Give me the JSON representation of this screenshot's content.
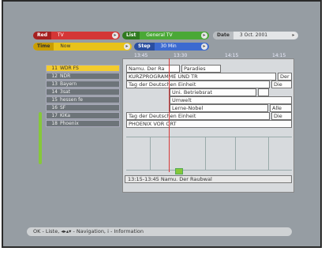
{
  "filters": {
    "red": {
      "tag": "Red",
      "value": "TV"
    },
    "green": {
      "tag": "List",
      "value": "General TV"
    },
    "yellow": {
      "tag": "Time",
      "value": "Now"
    },
    "blue": {
      "tag": "Step",
      "value": "30 Min"
    },
    "date": {
      "tag": "Date",
      "value": "3 Oct. 2001"
    }
  },
  "timeline": [
    "13:45",
    "13:30",
    "14:15",
    "14:15"
  ],
  "channels": [
    {
      "num": "11",
      "name": "WDR FS",
      "selected": true
    },
    {
      "num": "12",
      "name": "NDR",
      "selected": false
    },
    {
      "num": "13",
      "name": "Bayern",
      "selected": false
    },
    {
      "num": "14",
      "name": "3sat",
      "selected": false
    },
    {
      "num": "15",
      "name": "hessen fe",
      "selected": false
    },
    {
      "num": "16",
      "name": "SF",
      "selected": false
    },
    {
      "num": "17",
      "name": "KiKa",
      "selected": false
    },
    {
      "num": "18",
      "name": "Phoenix",
      "selected": false
    }
  ],
  "programs": [
    [
      "Namu. Der Ra",
      "Paradies"
    ],
    [
      "KURZPROGRAMME UND TR",
      "Der"
    ],
    [
      "Tag der Deutschen Einheit",
      "Die"
    ],
    [
      "Uni. Betriebsrat",
      ""
    ],
    [
      "Umwelt",
      ""
    ],
    [
      "Lerne-Nobel",
      "Alle"
    ],
    [
      "Tag der Deutschen Einheit",
      "Die"
    ],
    [
      "PHOENIX VOR ORT",
      ""
    ]
  ],
  "info": "13:15-13:45 Namu. Der Raubwal",
  "hint": "OK - Liste, ◂▸▴▾ - Navigation, i - Information",
  "colors": {
    "red": "#d43636",
    "green": "#4aa836",
    "yellow": "#e8c21a",
    "blue": "#3c6ad0",
    "select": "#f3cc2e"
  }
}
